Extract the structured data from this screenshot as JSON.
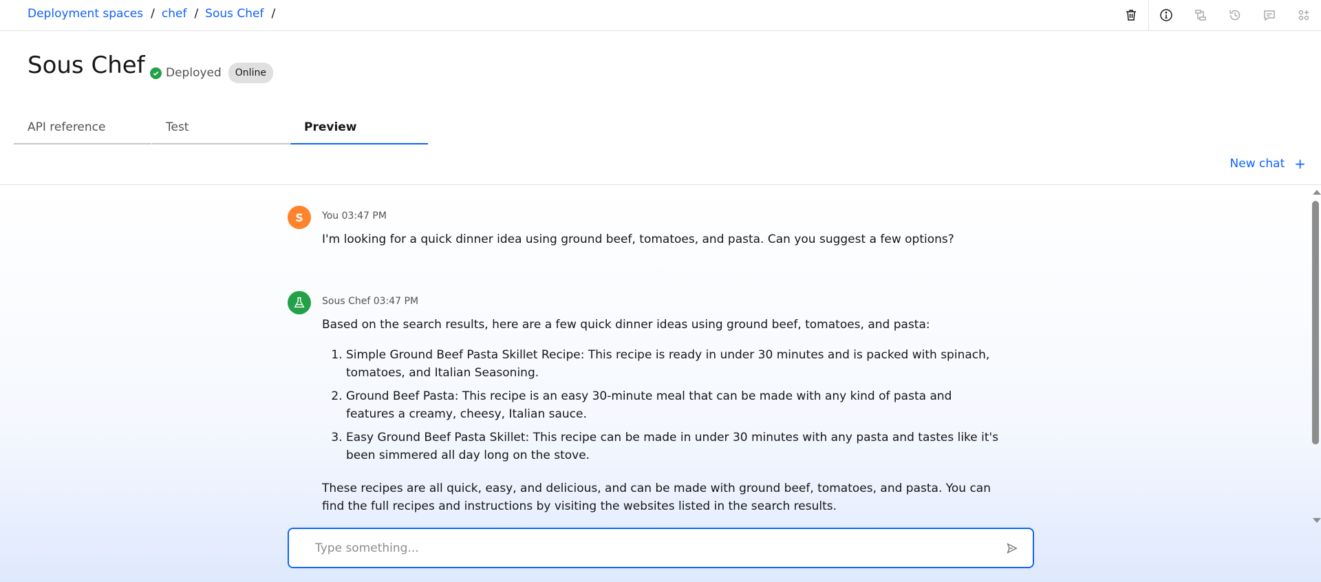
{
  "breadcrumb": {
    "items": [
      "Deployment spaces",
      "chef",
      "Sous Chef"
    ],
    "separator": "/"
  },
  "toolbar": {
    "icons": [
      "trash-icon",
      "info-icon",
      "flow-icon",
      "history-icon",
      "chat-icon",
      "apps-icon"
    ]
  },
  "header": {
    "title": "Sous Chef",
    "status": "Deployed",
    "badge": "Online"
  },
  "tabs": [
    {
      "label": "API reference",
      "active": false
    },
    {
      "label": "Test",
      "active": false
    },
    {
      "label": "Preview",
      "active": true
    }
  ],
  "new_chat": {
    "label": "New chat",
    "icon": "+"
  },
  "messages": {
    "user": {
      "avatar": "S",
      "meta": "You 03:47 PM",
      "text": "I'm looking for a quick dinner idea using ground beef, tomatoes, and pasta. Can you suggest a few options?"
    },
    "bot": {
      "meta": "Sous Chef 03:47 PM",
      "intro": "Based on the search results, here are a few quick dinner ideas using ground beef, tomatoes, and pasta:",
      "items": [
        "Simple Ground Beef Pasta Skillet Recipe: This recipe is ready in under 30 minutes and is packed with spinach, tomatoes, and Italian Seasoning.",
        "Ground Beef Pasta: This recipe is an easy 30-minute meal that can be made with any kind of pasta and features a creamy, cheesy, Italian sauce.",
        "Easy Ground Beef Pasta Skillet: This recipe can be made in under 30 minutes with any pasta and tastes like it's been simmered all day long on the stove."
      ],
      "outro": "These recipes are all quick, easy, and delicious, and can be made with ground beef, tomatoes, and pasta. You can find the full recipes and instructions by visiting the websites listed in the search results."
    }
  },
  "input": {
    "placeholder": "Type something...",
    "value": ""
  },
  "colors": {
    "accent": "#0f62fe",
    "success": "#24a148",
    "user_avatar": "#ff832b"
  }
}
